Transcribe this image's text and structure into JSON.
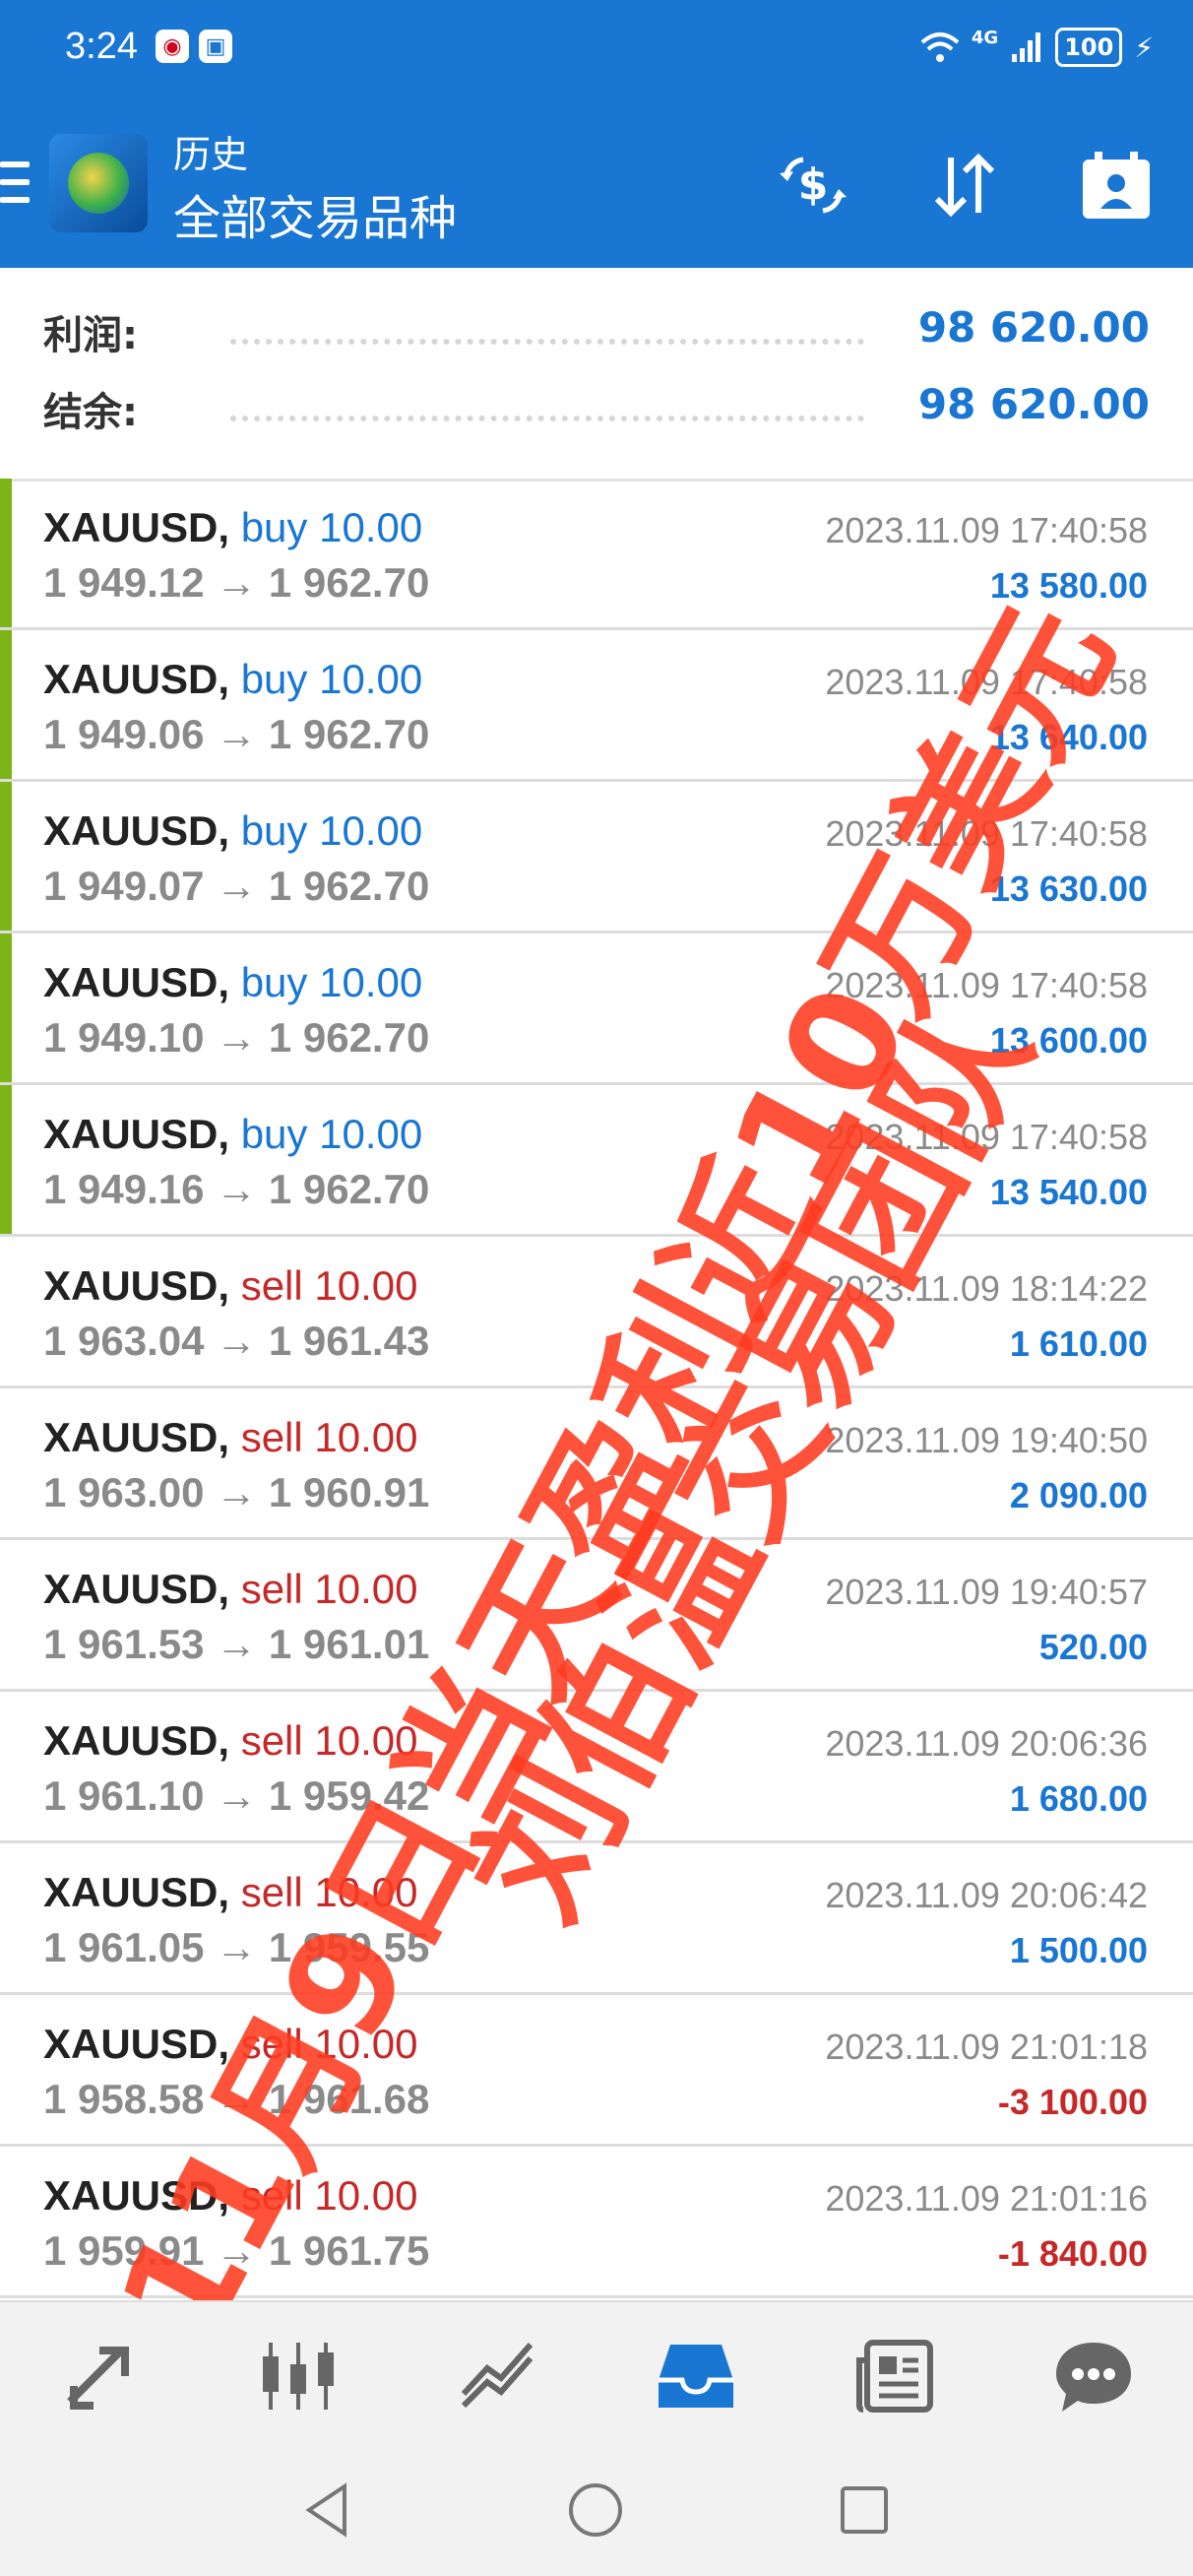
{
  "status_bar": {
    "time": "3:24",
    "network": "4G",
    "battery": "100"
  },
  "toolbar": {
    "title": "历史",
    "subtitle": "全部交易品种"
  },
  "summary": [
    {
      "label": "利润:",
      "value": "98 620.00"
    },
    {
      "label": "结余:",
      "value": "98 620.00"
    }
  ],
  "trades": [
    {
      "symbol": "XAUUSD,",
      "direction": "buy 10.00",
      "type": "buy",
      "prices": "1 949.12 → 1 962.70",
      "time": "2023.11.09 17:40:58",
      "profit": "13 580.00"
    },
    {
      "symbol": "XAUUSD,",
      "direction": "buy 10.00",
      "type": "buy",
      "prices": "1 949.06 → 1 962.70",
      "time": "2023.11.09 17:40:58",
      "profit": "13 640.00"
    },
    {
      "symbol": "XAUUSD,",
      "direction": "buy 10.00",
      "type": "buy",
      "prices": "1 949.07 → 1 962.70",
      "time": "2023.11.09 17:40:58",
      "profit": "13 630.00"
    },
    {
      "symbol": "XAUUSD,",
      "direction": "buy 10.00",
      "type": "buy",
      "prices": "1 949.10 → 1 962.70",
      "time": "2023.11.09 17:40:58",
      "profit": "13 600.00"
    },
    {
      "symbol": "XAUUSD,",
      "direction": "buy 10.00",
      "type": "buy",
      "prices": "1 949.16 → 1 962.70",
      "time": "2023.11.09 17:40:58",
      "profit": "13 540.00"
    },
    {
      "symbol": "XAUUSD,",
      "direction": "sell 10.00",
      "type": "sell",
      "prices": "1 963.04 → 1 961.43",
      "time": "2023.11.09 18:14:22",
      "profit": "1 610.00"
    },
    {
      "symbol": "XAUUSD,",
      "direction": "sell 10.00",
      "type": "sell",
      "prices": "1 963.00 → 1 960.91",
      "time": "2023.11.09 19:40:50",
      "profit": "2 090.00"
    },
    {
      "symbol": "XAUUSD,",
      "direction": "sell 10.00",
      "type": "sell",
      "prices": "1 961.53 → 1 961.01",
      "time": "2023.11.09 19:40:57",
      "profit": "520.00"
    },
    {
      "symbol": "XAUUSD,",
      "direction": "sell 10.00",
      "type": "sell",
      "prices": "1 961.10 → 1 959.42",
      "time": "2023.11.09 20:06:36",
      "profit": "1 680.00"
    },
    {
      "symbol": "XAUUSD,",
      "direction": "sell 10.00",
      "type": "sell",
      "prices": "1 961.05 → 1 959.55",
      "time": "2023.11.09 20:06:42",
      "profit": "1 500.00"
    },
    {
      "symbol": "XAUUSD,",
      "direction": "sell 10.00",
      "type": "sell",
      "prices": "1 958.58 → 1 961.68",
      "time": "2023.11.09 21:01:18",
      "profit": "-3 100.00"
    },
    {
      "symbol": "XAUUSD,",
      "direction": "sell 10.00",
      "type": "sell",
      "prices": "1 959.91 → 1 961.75",
      "time": "2023.11.09 21:01:16",
      "profit": "-1 840.00"
    }
  ],
  "watermark": {
    "line1": "11月9日当天盈利近10万美元",
    "line2": "刘伯温交易团队"
  },
  "colors": {
    "primary": "#1976d2",
    "buy": "#1976d2",
    "sell": "#c62828",
    "buy_marker": "#7cb518",
    "watermark": "#ff3b1f"
  },
  "bottom_nav": [
    {
      "icon": "trade-arrows-icon"
    },
    {
      "icon": "candlestick-icon"
    },
    {
      "icon": "trend-chart-icon"
    },
    {
      "icon": "history-inbox-icon",
      "active": true
    },
    {
      "icon": "news-icon"
    },
    {
      "icon": "chat-icon"
    }
  ],
  "system_nav": [
    {
      "icon": "back-icon"
    },
    {
      "icon": "home-icon"
    },
    {
      "icon": "recents-icon"
    }
  ]
}
